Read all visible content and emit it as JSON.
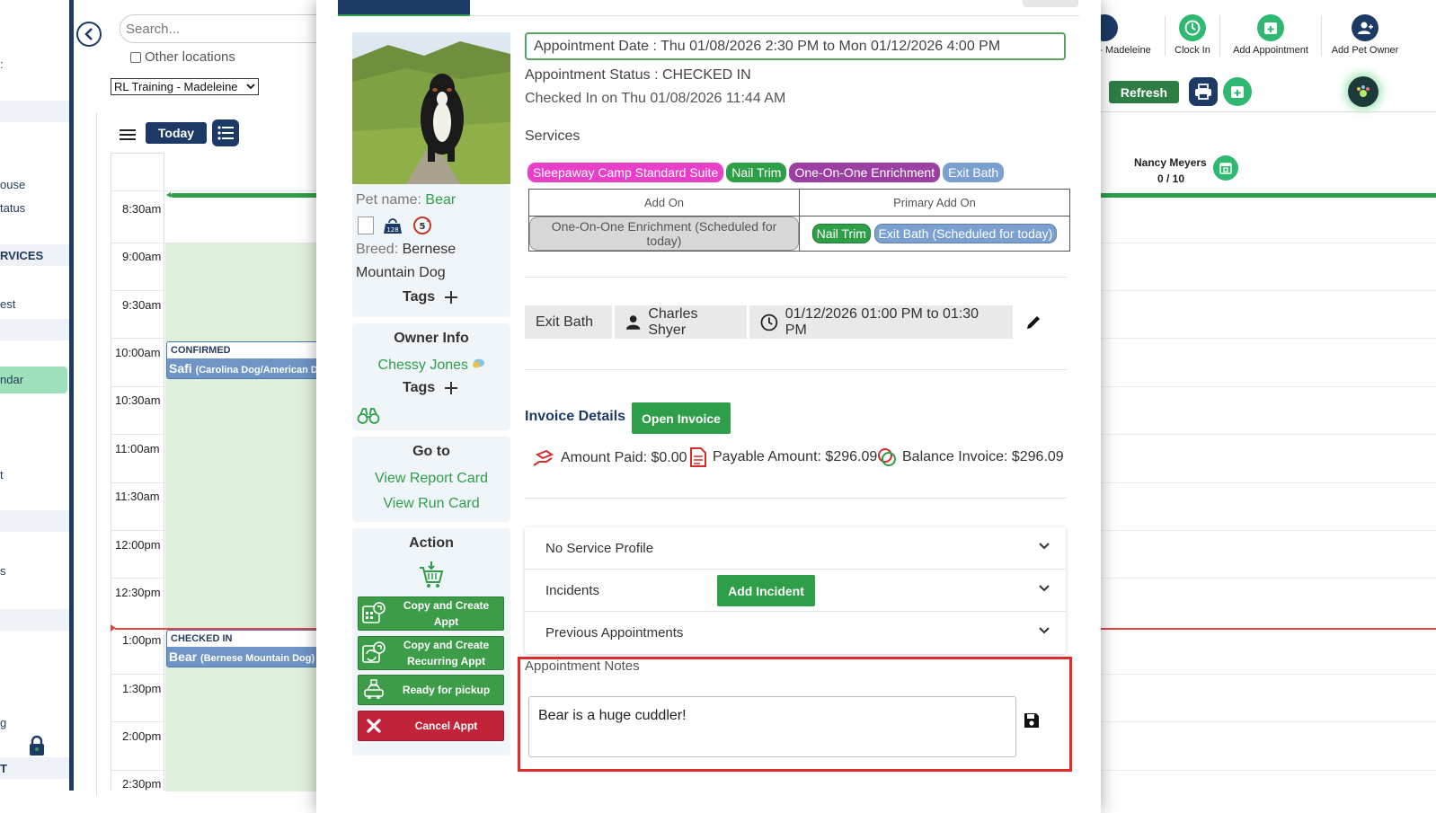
{
  "sidebar": {
    "items": [
      "ouse",
      "tatus",
      "RVICES",
      "est",
      "ndar",
      "t",
      "s",
      "g",
      "T"
    ]
  },
  "calendar": {
    "search_placeholder": "Search...",
    "other_locations": "Other locations",
    "location": "RL Training - Madeleine",
    "today": "Today",
    "times": [
      "8:30am",
      "9:00am",
      "9:30am",
      "10:00am",
      "10:30am",
      "11:00am",
      "11:30am",
      "12:00pm",
      "12:30pm",
      "1:00pm",
      "1:30pm",
      "2:00pm",
      "2:30pm"
    ],
    "appointments": [
      {
        "status": "CONFIRMED",
        "name": "Safi",
        "breed": "(Carolina Dog/American D"
      },
      {
        "status": "CHECKED IN",
        "name": "Bear",
        "breed": "(Bernese Mountain Dog)"
      }
    ]
  },
  "toolbar": {
    "location_short": "- Madeleine",
    "clock_in": "Clock In",
    "add_appointment": "Add Appointment",
    "add_pet_owner": "Add Pet Owner",
    "refresh": "Refresh"
  },
  "staff": {
    "name": "Nancy Meyers",
    "count": "0 / 10"
  },
  "modal": {
    "pet": {
      "name_label": "Pet name:",
      "name": "Bear",
      "breed_label": "Breed:",
      "breed_line1": "Bernese",
      "breed_line2": "Mountain Dog",
      "tags_label": "Tags",
      "badge_number": "5"
    },
    "owner": {
      "heading": "Owner Info",
      "name": "Chessy Jones",
      "tags_label": "Tags"
    },
    "goto": {
      "heading": "Go to",
      "report_card": "View Report Card",
      "run_card": "View Run Card"
    },
    "action": {
      "heading": "Action",
      "copy_create": [
        "Copy and Create",
        "Appt"
      ],
      "copy_recurring": [
        "Copy and Create",
        "Recurring Appt"
      ],
      "ready_pickup": "Ready for pickup",
      "cancel": "Cancel Appt"
    },
    "appointment_date": "Appointment Date : Thu 01/08/2026 2:30 PM to Mon 01/12/2026 4:00 PM",
    "status": "Appointment Status : CHECKED IN",
    "checked_in": "Checked In on Thu 01/08/2026 11:44 AM",
    "services_label": "Services",
    "services": [
      {
        "name": "Sleepaway Camp Standard Suite",
        "color": "#e83ec8"
      },
      {
        "name": "Nail Trim",
        "color": "#2e9e48"
      },
      {
        "name": "One-On-One Enrichment",
        "color": "#9b3fa3"
      },
      {
        "name": "Exit Bath",
        "color": "#7ba0d0"
      }
    ],
    "table": {
      "headers": [
        "Add On",
        "Primary Add On"
      ],
      "add_on": "One-On-One Enrichment (Scheduled for today)",
      "primary_nail": "Nail Trim",
      "primary_bath": "Exit Bath (Scheduled for today)"
    },
    "schedule": {
      "service": "Exit Bath",
      "staff": "Charles Shyer",
      "time": "01/12/2026 01:00 PM to 01:30 PM"
    },
    "invoice": {
      "heading": "Invoice Details",
      "open": "Open Invoice",
      "paid": "Amount Paid: $0.00",
      "payable": "Payable Amount: $296.09",
      "balance": "Balance Invoice: $296.09"
    },
    "accordion": {
      "service_profile": "No Service Profile",
      "incidents": "Incidents",
      "add_incident": "Add Incident",
      "previous": "Previous Appointments"
    },
    "notes": {
      "label": "Appointment Notes",
      "value": "Bear is a huge cuddler!"
    }
  },
  "colors": {
    "navy": "#1d3a66",
    "green": "#2e9e48",
    "highlight": "#e12a2a"
  }
}
